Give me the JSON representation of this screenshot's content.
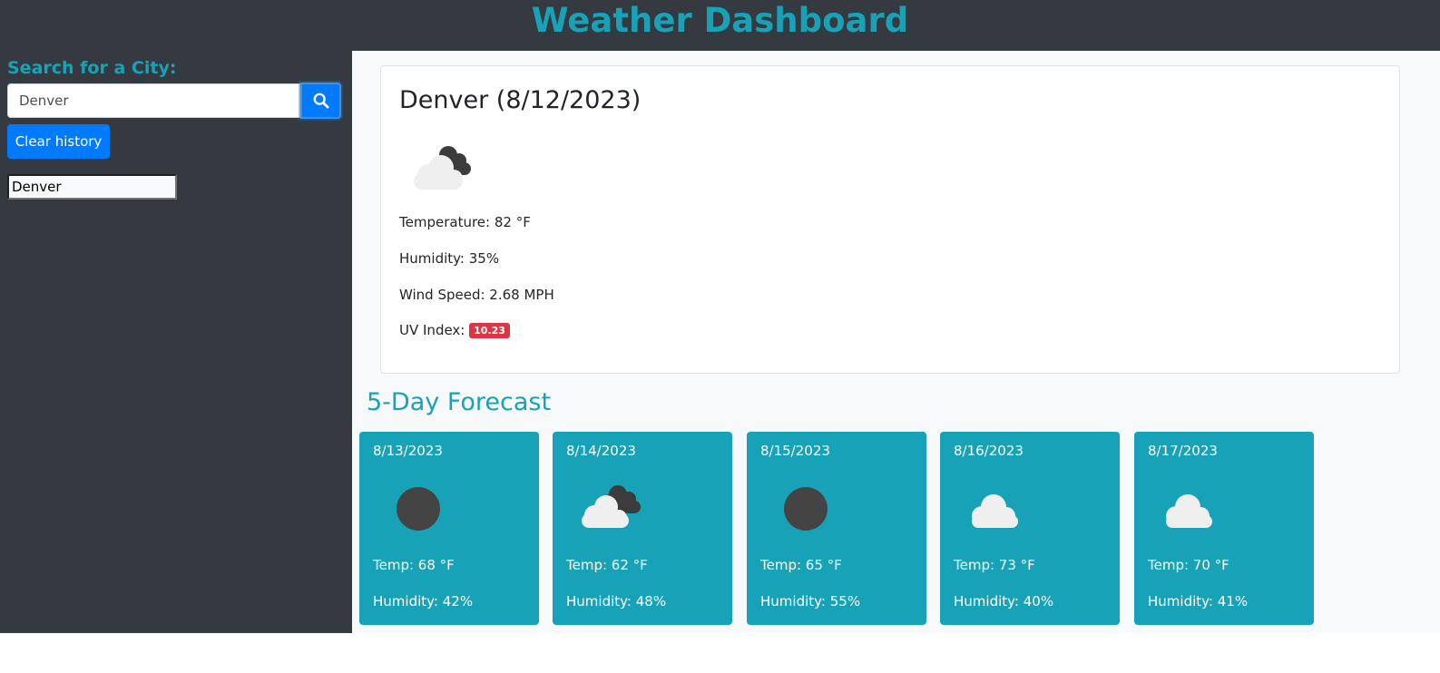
{
  "header": {
    "title": "Weather Dashboard"
  },
  "sidebar": {
    "search_label": "Search for a City:",
    "search_value": "Denver",
    "search_icon": "search-icon",
    "clear_label": "Clear history",
    "history": [
      "Denver"
    ]
  },
  "current": {
    "title": "Denver (8/12/2023)",
    "icon": "clouds-icon",
    "temperature": "Temperature: 82 °F",
    "humidity": "Humidity: 35%",
    "wind": "Wind Speed: 2.68 MPH",
    "uv_label": "UV Index:",
    "uv_value": "10.23"
  },
  "forecast": {
    "title": "5-Day Forecast",
    "days": [
      {
        "date": "8/13/2023",
        "icon": "clear-sky-icon",
        "temp": "Temp: 68 °F",
        "humidity": "Humidity: 42%"
      },
      {
        "date": "8/14/2023",
        "icon": "clouds-icon",
        "temp": "Temp: 62 °F",
        "humidity": "Humidity: 48%"
      },
      {
        "date": "8/15/2023",
        "icon": "clear-sky-icon",
        "temp": "Temp: 65 °F",
        "humidity": "Humidity: 55%"
      },
      {
        "date": "8/16/2023",
        "icon": "cloud-icon",
        "temp": "Temp: 73 °F",
        "humidity": "Humidity: 40%"
      },
      {
        "date": "8/17/2023",
        "icon": "cloud-icon",
        "temp": "Temp: 70 °F",
        "humidity": "Humidity: 41%"
      }
    ]
  },
  "colors": {
    "header_bg": "#343a40",
    "accent": "#17a2b8",
    "primary": "#007bff",
    "uv_danger": "#dc3545"
  }
}
